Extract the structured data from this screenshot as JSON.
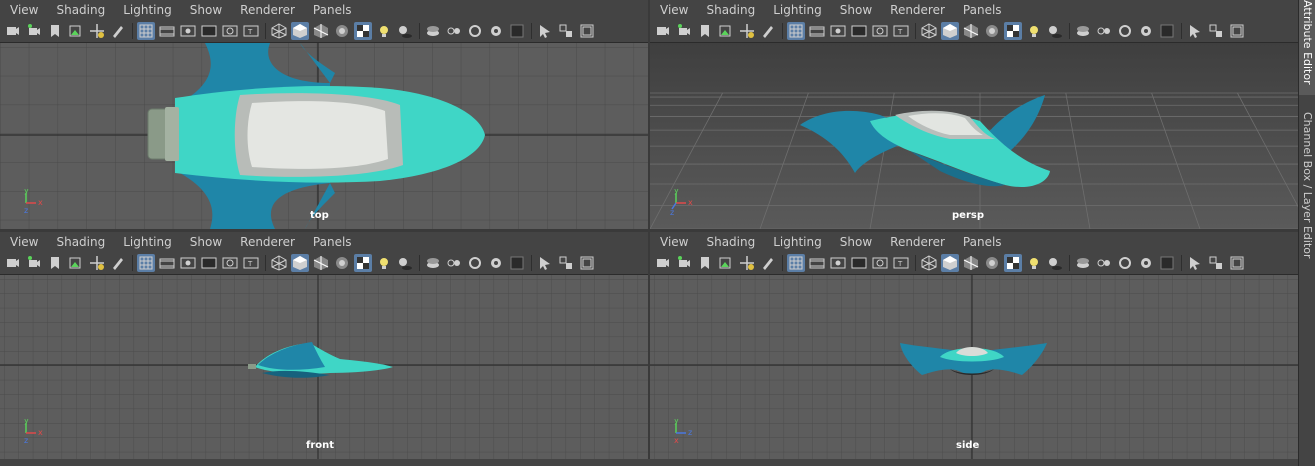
{
  "viewports": [
    {
      "id": "top",
      "camera": "top"
    },
    {
      "id": "persp",
      "camera": "persp"
    },
    {
      "id": "front",
      "camera": "front"
    },
    {
      "id": "side",
      "camera": "side"
    }
  ],
  "menu": [
    "View",
    "Shading",
    "Lighting",
    "Show",
    "Renderer",
    "Panels"
  ],
  "side_tabs": {
    "attribute_editor": "Attribute Editor",
    "channel_box": "Channel Box / Layer Editor"
  },
  "axis": {
    "x": "x",
    "y": "y",
    "z": "z"
  },
  "colors": {
    "accent_active": "#5b7ea6",
    "ship_teal": "#3fd6c6",
    "ship_blue": "#1f86a8",
    "ship_cockpit": "#d9dcd8"
  },
  "toolbar_icons": [
    "camera-select-icon",
    "camera-attributes-icon",
    "bookmark-icon",
    "image-plane-icon",
    "2d-pan-zoom-icon",
    "grease-pencil-icon",
    "grid-icon",
    "film-gate-icon",
    "resolution-gate-icon",
    "gate-mask-icon",
    "field-chart-icon",
    "safe-title-icon",
    "wireframe-icon",
    "smooth-shade-icon",
    "wireframe-on-shaded-icon",
    "xray-icon",
    "textures-icon",
    "lights-icon",
    "shadows-icon",
    "isolate-select-icon",
    "xray-joints-icon",
    "ambient-occlusion-icon",
    "antialiasing-icon",
    "depth-of-field-icon",
    "select-camera-icon",
    "layout-icon",
    "exposure-icon"
  ]
}
